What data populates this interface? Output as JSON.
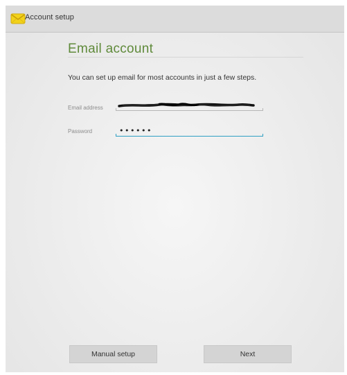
{
  "action_bar": {
    "title": "Account setup",
    "icon": "email-envelope-icon",
    "icon_color": "#f2d21a"
  },
  "main": {
    "title": "Email account",
    "intro": "You can set up email for most accounts in just a few steps.",
    "email": {
      "label": "Email address",
      "value": ""
    },
    "password": {
      "label": "Password",
      "value": "••••••"
    }
  },
  "buttons": {
    "manual_setup": "Manual setup",
    "next": "Next"
  },
  "colors": {
    "accent": "#2e9fc3",
    "title": "#5f8a3a"
  }
}
